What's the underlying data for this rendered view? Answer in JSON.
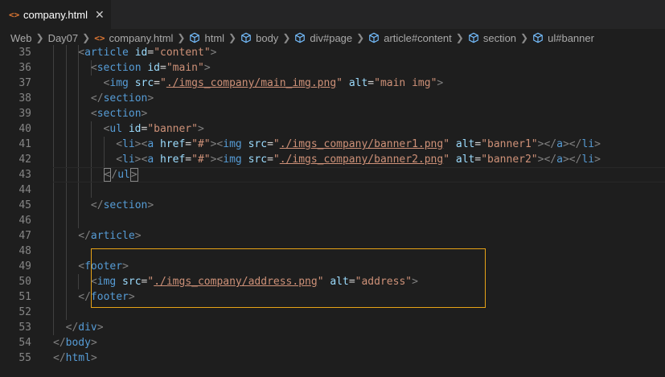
{
  "tab": {
    "title": "company.html",
    "icon": "html-file-icon",
    "close": "✕"
  },
  "breadcrumb": [
    {
      "label": "Web",
      "icon": null
    },
    {
      "label": "Day07",
      "icon": null
    },
    {
      "label": "company.html",
      "icon": "html-file-icon"
    },
    {
      "label": "html",
      "icon": "cube-icon"
    },
    {
      "label": "body",
      "icon": "cube-icon"
    },
    {
      "label": "div#page",
      "icon": "cube-icon"
    },
    {
      "label": "article#content",
      "icon": "cube-icon"
    },
    {
      "label": "section",
      "icon": "cube-icon"
    },
    {
      "label": "ul#banner",
      "icon": "cube-icon"
    }
  ],
  "lines": [
    {
      "num": "35",
      "indent": 4,
      "tokens": [
        [
          "br",
          "<"
        ],
        [
          "tag",
          "article"
        ],
        [
          "sp",
          " "
        ],
        [
          "attr",
          "id"
        ],
        [
          "eq",
          "="
        ],
        [
          "str",
          "\"content\""
        ],
        [
          "br",
          ">"
        ]
      ]
    },
    {
      "num": "36",
      "indent": 6,
      "tokens": [
        [
          "br",
          "<"
        ],
        [
          "tag",
          "section"
        ],
        [
          "sp",
          " "
        ],
        [
          "attr",
          "id"
        ],
        [
          "eq",
          "="
        ],
        [
          "str",
          "\"main\""
        ],
        [
          "br",
          ">"
        ]
      ]
    },
    {
      "num": "37",
      "indent": 8,
      "tokens": [
        [
          "br",
          "<"
        ],
        [
          "tag",
          "img"
        ],
        [
          "sp",
          " "
        ],
        [
          "attr",
          "src"
        ],
        [
          "eq",
          "="
        ],
        [
          "str",
          "\""
        ],
        [
          "link",
          "./imgs_company/main_img.png"
        ],
        [
          "str",
          "\""
        ],
        [
          "sp",
          " "
        ],
        [
          "attr",
          "alt"
        ],
        [
          "eq",
          "="
        ],
        [
          "str",
          "\"main img\""
        ],
        [
          "br",
          ">"
        ]
      ]
    },
    {
      "num": "38",
      "indent": 6,
      "tokens": [
        [
          "br",
          "</"
        ],
        [
          "tag",
          "section"
        ],
        [
          "br",
          ">"
        ]
      ]
    },
    {
      "num": "39",
      "indent": 6,
      "tokens": [
        [
          "br",
          "<"
        ],
        [
          "tag",
          "section"
        ],
        [
          "br",
          ">"
        ]
      ]
    },
    {
      "num": "40",
      "indent": 8,
      "tokens": [
        [
          "br",
          "<"
        ],
        [
          "tag",
          "ul"
        ],
        [
          "sp",
          " "
        ],
        [
          "attr",
          "id"
        ],
        [
          "eq",
          "="
        ],
        [
          "str",
          "\"banner\""
        ],
        [
          "br",
          ">"
        ]
      ]
    },
    {
      "num": "41",
      "indent": 10,
      "tokens": [
        [
          "br",
          "<"
        ],
        [
          "tag",
          "li"
        ],
        [
          "br",
          "><"
        ],
        [
          "tag",
          "a"
        ],
        [
          "sp",
          " "
        ],
        [
          "attr",
          "href"
        ],
        [
          "eq",
          "="
        ],
        [
          "str",
          "\"#\""
        ],
        [
          "br",
          "><"
        ],
        [
          "tag",
          "img"
        ],
        [
          "sp",
          " "
        ],
        [
          "attr",
          "src"
        ],
        [
          "eq",
          "="
        ],
        [
          "str",
          "\""
        ],
        [
          "link",
          "./imgs_company/banner1.png"
        ],
        [
          "str",
          "\""
        ],
        [
          "sp",
          " "
        ],
        [
          "attr",
          "alt"
        ],
        [
          "eq",
          "="
        ],
        [
          "str",
          "\"banner1\""
        ],
        [
          "br",
          "></"
        ],
        [
          "tag",
          "a"
        ],
        [
          "br",
          "></"
        ],
        [
          "tag",
          "li"
        ],
        [
          "br",
          ">"
        ]
      ]
    },
    {
      "num": "42",
      "indent": 10,
      "tokens": [
        [
          "br",
          "<"
        ],
        [
          "tag",
          "li"
        ],
        [
          "br",
          "><"
        ],
        [
          "tag",
          "a"
        ],
        [
          "sp",
          " "
        ],
        [
          "attr",
          "href"
        ],
        [
          "eq",
          "="
        ],
        [
          "str",
          "\"#\""
        ],
        [
          "br",
          "><"
        ],
        [
          "tag",
          "img"
        ],
        [
          "sp",
          " "
        ],
        [
          "attr",
          "src"
        ],
        [
          "eq",
          "="
        ],
        [
          "str",
          "\""
        ],
        [
          "link",
          "./imgs_company/banner2.png"
        ],
        [
          "str",
          "\""
        ],
        [
          "sp",
          " "
        ],
        [
          "attr",
          "alt"
        ],
        [
          "eq",
          "="
        ],
        [
          "str",
          "\"banner2\""
        ],
        [
          "br",
          "></"
        ],
        [
          "tag",
          "a"
        ],
        [
          "br",
          "></"
        ],
        [
          "tag",
          "li"
        ],
        [
          "br",
          ">"
        ]
      ]
    },
    {
      "num": "43",
      "indent": 8,
      "tokens": [
        [
          "match",
          "<"
        ],
        [
          "br",
          "/"
        ],
        [
          "tag",
          "ul"
        ],
        [
          "match",
          ">"
        ]
      ]
    },
    {
      "num": "44",
      "indent": 0,
      "tokens": []
    },
    {
      "num": "45",
      "indent": 6,
      "tokens": [
        [
          "br",
          "</"
        ],
        [
          "tag",
          "section"
        ],
        [
          "br",
          ">"
        ]
      ]
    },
    {
      "num": "46",
      "indent": 0,
      "tokens": []
    },
    {
      "num": "47",
      "indent": 4,
      "tokens": [
        [
          "br",
          "</"
        ],
        [
          "tag",
          "article"
        ],
        [
          "br",
          ">"
        ]
      ]
    },
    {
      "num": "48",
      "indent": 0,
      "tokens": []
    },
    {
      "num": "49",
      "indent": 4,
      "tokens": [
        [
          "br",
          "<"
        ],
        [
          "tag",
          "footer"
        ],
        [
          "br",
          ">"
        ]
      ]
    },
    {
      "num": "50",
      "indent": 6,
      "tokens": [
        [
          "br",
          "<"
        ],
        [
          "tag",
          "img"
        ],
        [
          "sp",
          " "
        ],
        [
          "attr",
          "src"
        ],
        [
          "eq",
          "="
        ],
        [
          "str",
          "\""
        ],
        [
          "link",
          "./imgs_company/address.png"
        ],
        [
          "str",
          "\""
        ],
        [
          "sp",
          " "
        ],
        [
          "attr",
          "alt"
        ],
        [
          "eq",
          "="
        ],
        [
          "str",
          "\"address\""
        ],
        [
          "br",
          ">"
        ]
      ]
    },
    {
      "num": "51",
      "indent": 4,
      "tokens": [
        [
          "br",
          "</"
        ],
        [
          "tag",
          "footer"
        ],
        [
          "br",
          ">"
        ]
      ]
    },
    {
      "num": "52",
      "indent": 0,
      "tokens": []
    },
    {
      "num": "53",
      "indent": 2,
      "tokens": [
        [
          "br",
          "</"
        ],
        [
          "tag",
          "div"
        ],
        [
          "br",
          ">"
        ]
      ]
    },
    {
      "num": "54",
      "indent": 0,
      "tokens": [
        [
          "br",
          "</"
        ],
        [
          "tag",
          "body"
        ],
        [
          "br",
          ">"
        ]
      ]
    },
    {
      "num": "55",
      "indent": 0,
      "tokens": [
        [
          "br",
          "</"
        ],
        [
          "tag",
          "html"
        ],
        [
          "br",
          ">"
        ]
      ]
    }
  ],
  "colors": {
    "background": "#1e1e1e",
    "tag": "#569cd6",
    "attribute": "#9cdcfe",
    "string": "#ce9178",
    "bracket": "#808080",
    "highlight": "#e8a317"
  }
}
